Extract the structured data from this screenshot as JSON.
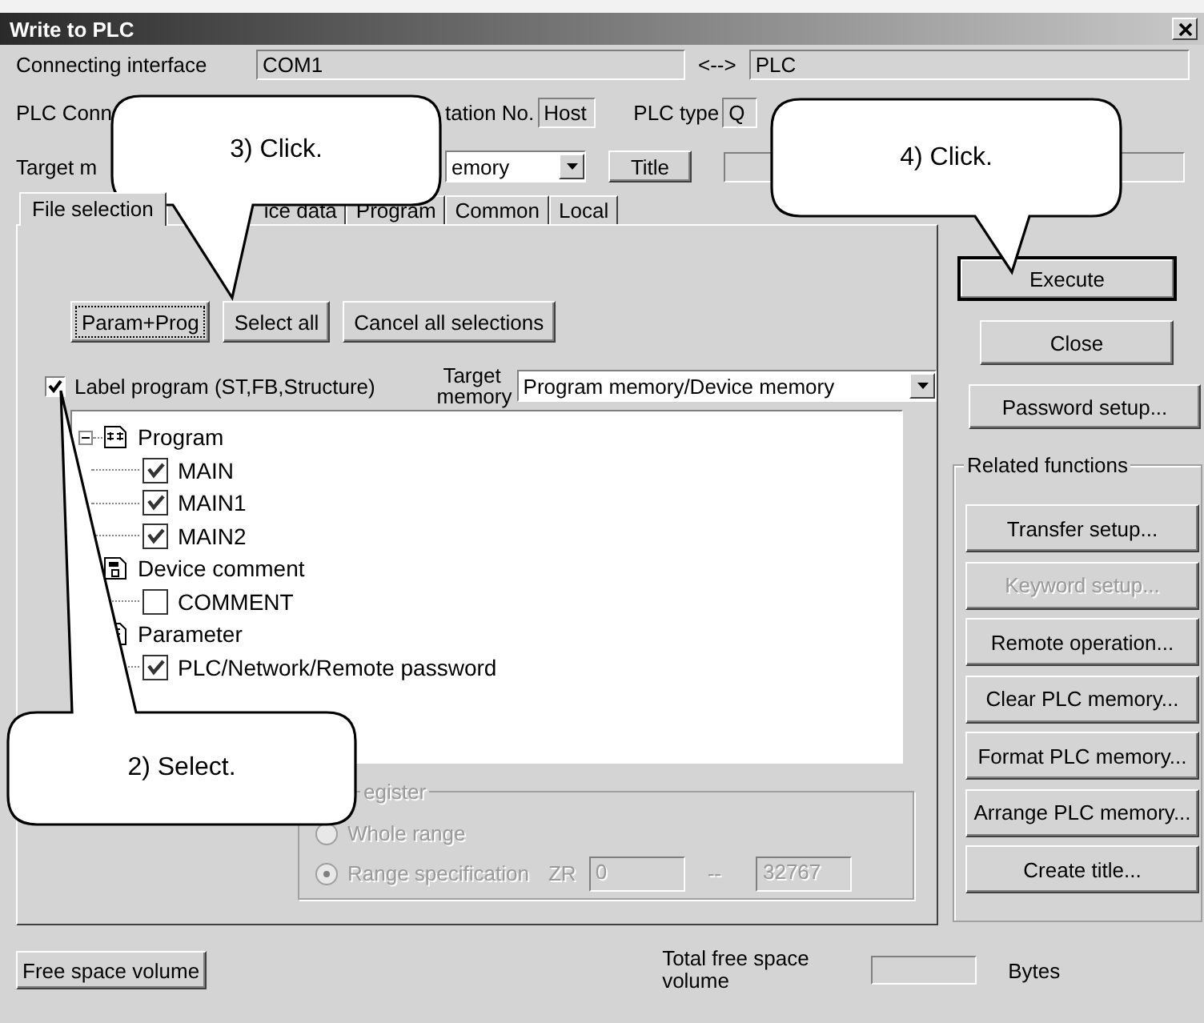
{
  "window": {
    "title": "Write to PLC"
  },
  "connection": {
    "label": "Connecting interface",
    "interface": "COM1",
    "separator": "<-->",
    "target": "PLC"
  },
  "plc": {
    "label": "PLC Conn",
    "station_label": "tation No.",
    "station": "Host",
    "type_label": "PLC type",
    "type": "Q"
  },
  "target": {
    "label": "Target m",
    "memory": "emory",
    "title_button": "Title"
  },
  "tabs": [
    {
      "label": "File selection",
      "selected": true
    },
    {
      "label": "ice data",
      "selected": false
    },
    {
      "label": "Program",
      "selected": false
    },
    {
      "label": "Common",
      "selected": false
    },
    {
      "label": "Local",
      "selected": false
    }
  ],
  "file_buttons": [
    {
      "label": "Param+Prog",
      "focused": true
    },
    {
      "label": "Select all",
      "focused": false
    },
    {
      "label": "Cancel all selections",
      "focused": false
    }
  ],
  "label_program": {
    "label": "Label program (ST,FB,Structure)",
    "checked": true
  },
  "target_memory": {
    "label": "Target memory",
    "value": "Program memory/Device memory"
  },
  "tree": [
    {
      "label": "Program",
      "kind": "program",
      "children": [
        {
          "label": "MAIN",
          "checked": true
        },
        {
          "label": "MAIN1",
          "checked": true
        },
        {
          "label": "MAIN2",
          "checked": true
        }
      ]
    },
    {
      "label": "Device comment",
      "kind": "comment",
      "children": [
        {
          "label": "COMMENT",
          "checked": false
        }
      ]
    },
    {
      "label": "Parameter",
      "kind": "parameter",
      "children": [
        {
          "label": "PLC/Network/Remote password",
          "checked": true
        }
      ]
    }
  ],
  "register_group": {
    "title": "egister",
    "disabled": true,
    "options": [
      {
        "label": "Whole range",
        "selected": false
      },
      {
        "label": "Range specification",
        "selected": true
      }
    ],
    "prefix": "ZR",
    "start": "0",
    "dash": "--",
    "end": "32767"
  },
  "actions": [
    {
      "label": "Execute",
      "default": true
    },
    {
      "label": "Close",
      "default": false
    },
    {
      "label": "Password setup...",
      "default": false
    }
  ],
  "related": {
    "title": "Related functions",
    "buttons": [
      {
        "label": "Transfer setup...",
        "disabled": false
      },
      {
        "label": "Keyword setup...",
        "disabled": true
      },
      {
        "label": "Remote operation...",
        "disabled": false
      },
      {
        "label": "Clear PLC memory...",
        "disabled": false
      },
      {
        "label": "Format PLC memory...",
        "disabled": false
      },
      {
        "label": "Arrange PLC memory...",
        "disabled": false
      },
      {
        "label": "Create title...",
        "disabled": false
      }
    ]
  },
  "footer": {
    "button": "Free space volume",
    "total_label": "Total free space volume",
    "unit": "Bytes"
  },
  "callouts": [
    {
      "text": "3) Click."
    },
    {
      "text": "4) Click."
    },
    {
      "text": "2) Select."
    }
  ]
}
